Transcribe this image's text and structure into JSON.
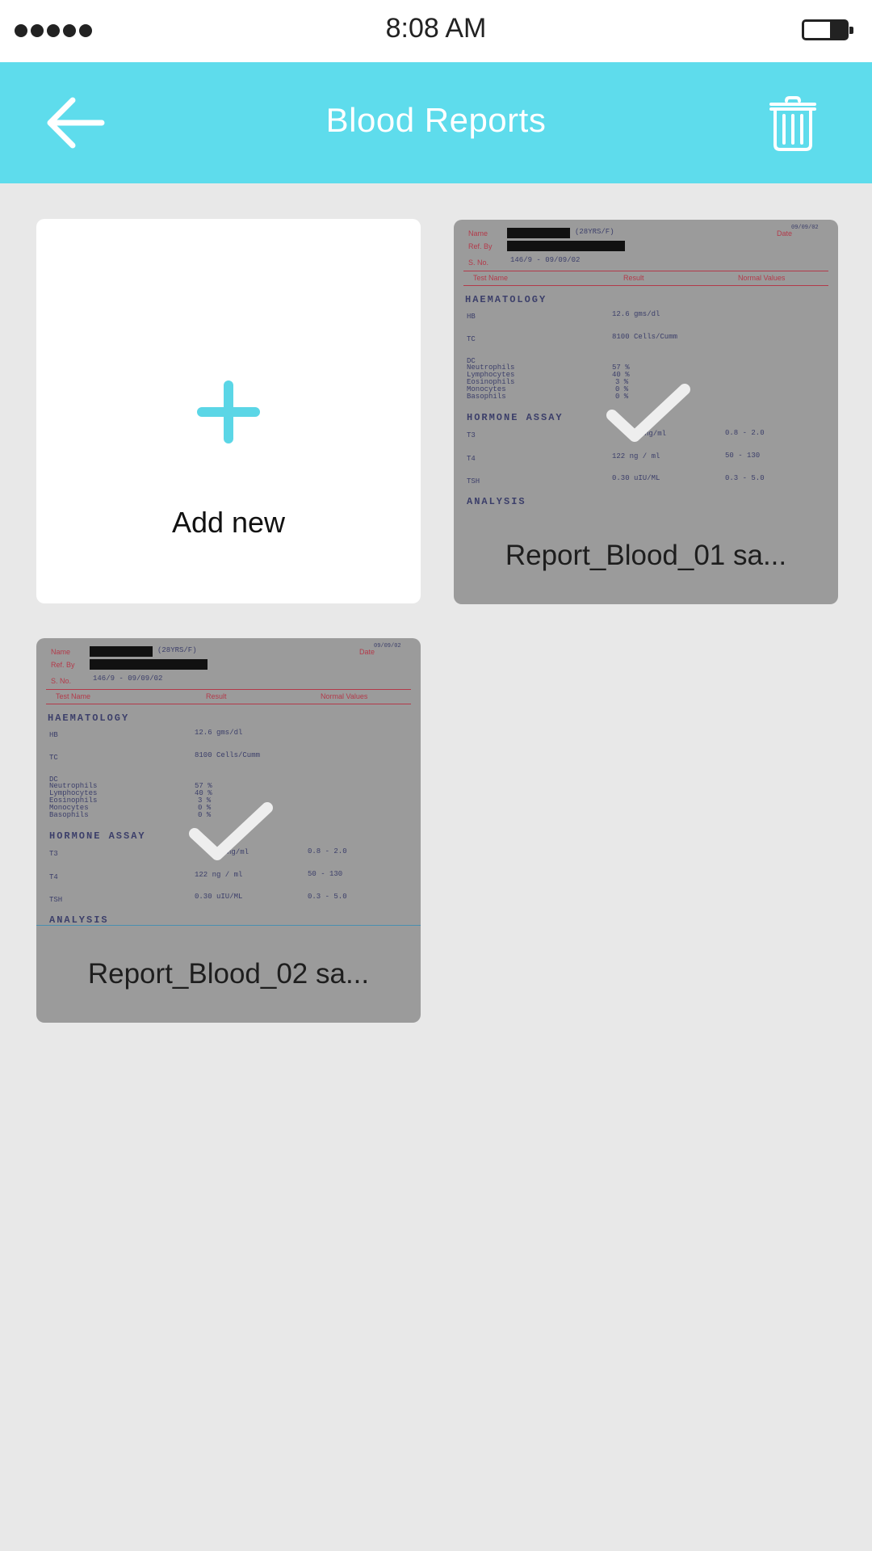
{
  "status_bar": {
    "time": "8:08 AM"
  },
  "header": {
    "title": "Blood Reports"
  },
  "add_card": {
    "label": "Add new"
  },
  "reports": [
    {
      "label": "Report_Blood_01 sa...",
      "selected": true
    },
    {
      "label": "Report_Blood_02 sa...",
      "selected": true
    }
  ],
  "document": {
    "name_label": "Name",
    "age_sex": "(28YRS/F)",
    "date_label": "Date",
    "date_value": "09/09/02",
    "ref_label": "Ref. By",
    "sno_label": "S. No.",
    "sno_value": "146/9 - 09/09/02",
    "col_test": "Test Name",
    "col_result": "Result",
    "col_normal": "Normal Values",
    "section_haematology": "HAEMATOLOGY",
    "hb_label": "HB",
    "hb_value": "12.6 gms/dl",
    "tc_label": "TC",
    "tc_value": "8100 Cells/Cumm",
    "dc_label": "DC",
    "dc_rows": [
      "Neutrophils",
      "Lymphocytes",
      "Eosinophils",
      "Monocytes",
      "Basophils"
    ],
    "dc_values": [
      "57 %",
      "40 %",
      "3 %",
      "0 %",
      "0 %"
    ],
    "section_hormone": "HORMONE ASSAY",
    "t3_label": "T3",
    "t3_value": "ng/ml",
    "t3_normal": "0.8 - 2.0",
    "t4_label": "T4",
    "t4_value": "122   ng / ml",
    "t4_normal": "50 - 130",
    "tsh_label": "TSH",
    "tsh_value": "0.30   uIU/ML",
    "tsh_normal": "0.3 - 5.0",
    "section_analysis": "ANALYSIS"
  },
  "colors": {
    "accent": "#5edcec",
    "plus": "#5bd6e6",
    "selected_overlay": "#9b9b9b"
  }
}
